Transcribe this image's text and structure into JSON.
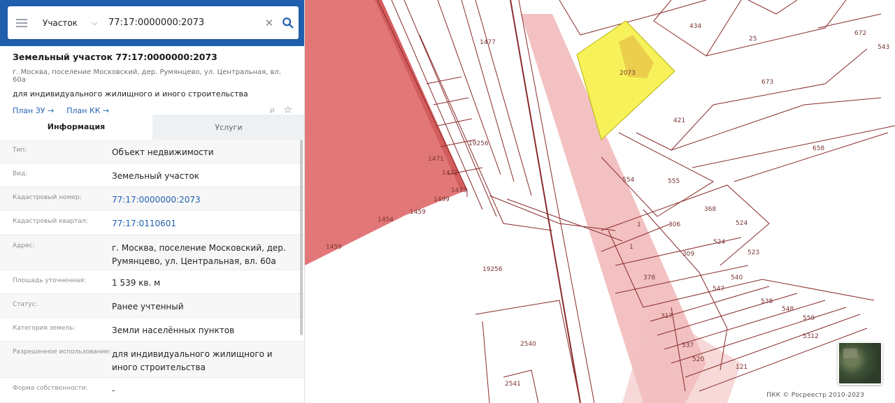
{
  "search": {
    "type_label": "Участок",
    "value": "77:17:0000000:2073"
  },
  "object": {
    "title": "Земельный участок 77:17:0000000:2073",
    "address_short": "г. Москва, поселение Московский, дер. Румянцево, ул. Центральная, вл. 60а",
    "purpose": "для индивидуального жилищного и иного строительства",
    "link_plan_zu": "План ЗУ →",
    "link_plan_kk": "План КК →"
  },
  "tabs": {
    "info": "Информация",
    "services": "Услуги"
  },
  "fields": [
    {
      "key": "Тип:",
      "value": "Объект недвижимости"
    },
    {
      "key": "Вид:",
      "value": "Земельный участок"
    },
    {
      "key": "Кадастровый номер:",
      "value": "77:17:0000000:2073"
    },
    {
      "key": "Кадастровый квартал:",
      "value": "77:17:0110601"
    },
    {
      "key": "Адрес:",
      "value": "г. Москва, поселение Московский, дер. Румянцево, ул. Центральная, вл. 60а"
    },
    {
      "key": "Площадь уточненная:",
      "value": "1 539 кв. м"
    },
    {
      "key": "Статус:",
      "value": "Ранее учтенный"
    },
    {
      "key": "Категория земель:",
      "value": "Земли населённых пунктов"
    },
    {
      "key": "Разрешенное использование:",
      "value": "для индивидуального жилищного и иного строительства"
    },
    {
      "key": "Форма собственности:",
      "value": "-"
    }
  ],
  "map": {
    "labels": [
      "2073",
      "25",
      "434",
      "672",
      "543",
      "673",
      "658",
      "421",
      "555",
      "554",
      "368",
      "306",
      "524",
      "1",
      "1",
      "309",
      "523",
      "378",
      "540",
      "547",
      "524",
      "538",
      "548",
      "559",
      "317",
      "537",
      "520",
      "121",
      "2540",
      "2541",
      "5312",
      "19256",
      "19256",
      "1477",
      "1454",
      "1459",
      "1459",
      "1499",
      "1471",
      "1472",
      "1473"
    ],
    "attribution": "ПКК © Росреестр 2010-2023"
  },
  "colors": {
    "accent": "#1f5fae",
    "selected_parcel": "#f7f25a",
    "red_zone": "#e07070",
    "boundary": "#8a2b2b"
  }
}
